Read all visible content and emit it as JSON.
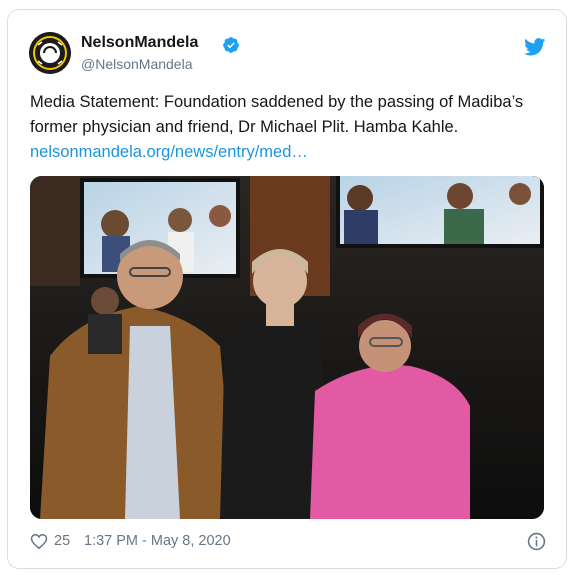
{
  "tweet": {
    "author_name": "NelsonMandela",
    "handle": "@NelsonMandela",
    "verified": true,
    "text_before_link": "Media Statement: Foundation saddened by the passing of Madiba’s former physician and friend, Dr Michael Plit. Hamba Kahle. ",
    "link_text": "nelsonmandela.org/news/entry/med…",
    "likes": "25",
    "timestamp": "1:37 PM - May 8, 2020"
  },
  "avatar": {
    "text": "EACH ONE TEACH ONE"
  },
  "icons": {
    "verified": "verified-badge-icon",
    "brand": "twitter-bird-icon",
    "like": "heart-icon",
    "info": "info-icon"
  },
  "colors": {
    "link": "#1b95e0",
    "brand": "#1da1f2",
    "secondary_text": "#657786",
    "border": "#d9dde1"
  }
}
